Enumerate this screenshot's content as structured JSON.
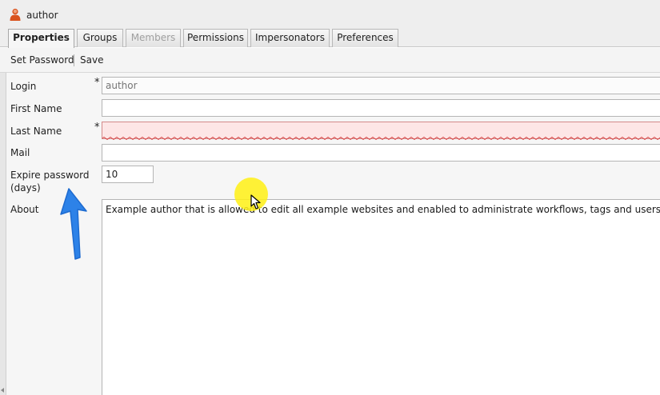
{
  "window": {
    "title": "author",
    "icon": "user-icon"
  },
  "tabs": [
    {
      "label": "Properties",
      "state": "active"
    },
    {
      "label": "Groups",
      "state": "normal"
    },
    {
      "label": "Members",
      "state": "disabled"
    },
    {
      "label": "Permissions",
      "state": "normal"
    },
    {
      "label": "Impersonators",
      "state": "normal"
    },
    {
      "label": "Preferences",
      "state": "normal"
    }
  ],
  "toolbar": {
    "set_password_label": "Set Password",
    "save_label": "Save"
  },
  "form": {
    "login": {
      "label": "Login",
      "required_mark": "*",
      "placeholder": "author"
    },
    "first_name": {
      "label": "First Name",
      "value": ""
    },
    "last_name": {
      "label": "Last Name",
      "required_mark": "*",
      "value": ""
    },
    "mail": {
      "label": "Mail",
      "value": ""
    },
    "expire_password": {
      "label_line1": "Expire password",
      "label_line2": "(days)",
      "value": "10"
    },
    "about": {
      "label": "About",
      "value": "Example author that is allowed to edit all example websites and enabled to administrate workflows, tags and users."
    }
  },
  "colors": {
    "invalid_field_bg": "#fde6e6",
    "annotation_arrow": "#2d82e8",
    "cursor_highlight": "#fff014"
  },
  "overlay": {
    "annotation_icon": "up-arrow-icon",
    "cursor_icon": "mouse-pointer-icon"
  }
}
